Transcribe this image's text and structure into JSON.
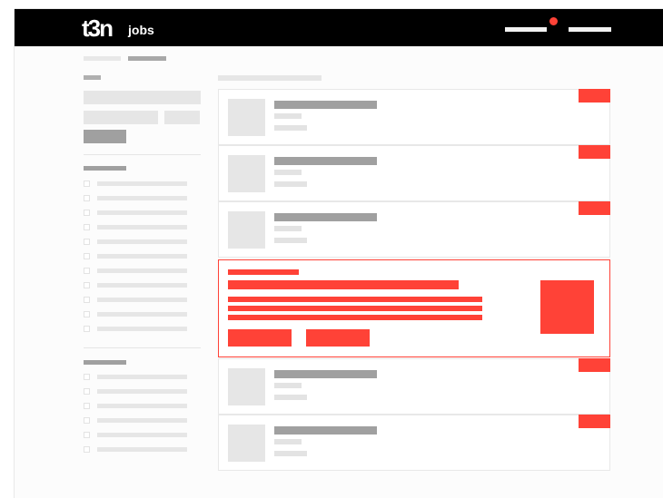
{
  "header": {
    "logo_text": "t3n",
    "logo_subtext": "jobs",
    "notification_color": "#ff4237"
  },
  "colors": {
    "accent": "#ff4237",
    "placeholder_dark": "#a0a0a0",
    "placeholder_light": "#e6e6e6"
  },
  "sidebar": {
    "filter_group_1_count": 11,
    "filter_group_2_count": 6
  },
  "results": {
    "job_cards_before_promo": 3,
    "job_cards_after_promo": 2
  }
}
